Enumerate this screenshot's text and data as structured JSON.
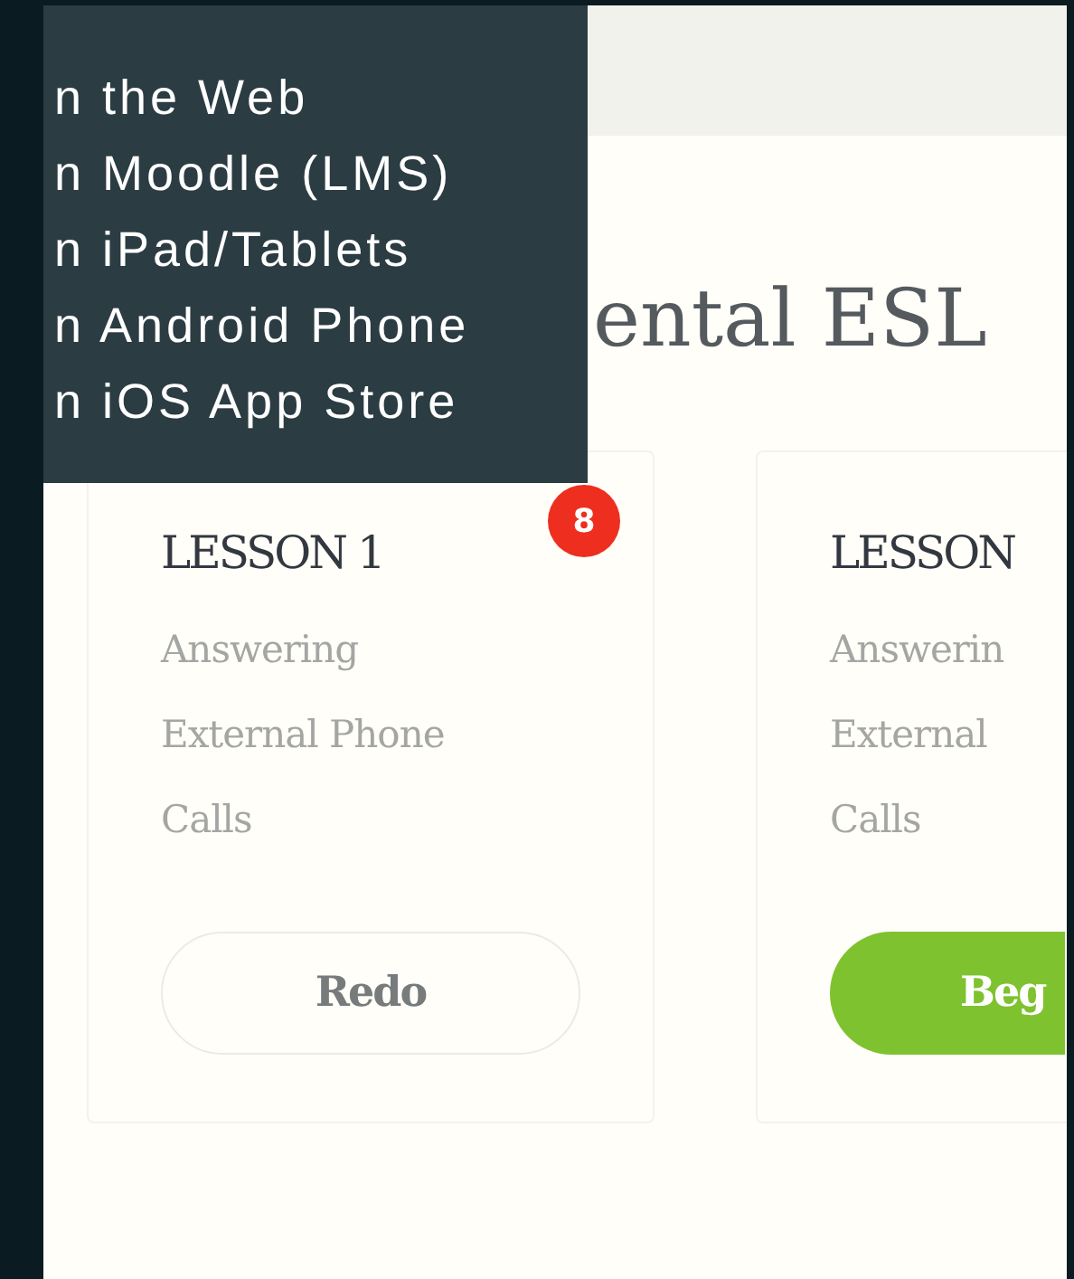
{
  "title": "ental ESL",
  "menu": {
    "items": [
      "n the Web",
      "n Moodle (LMS)",
      "n iPad/Tablets",
      "n Android Phone",
      "n iOS App Store"
    ]
  },
  "lessons": [
    {
      "title": "LESSON 1",
      "badge": "8",
      "description": [
        "Answering",
        "External Phone",
        "Calls"
      ],
      "button": {
        "label": "Redo",
        "kind": "outline"
      }
    },
    {
      "title": "LESSON",
      "description": [
        "Answerin",
        "External",
        "Calls"
      ],
      "button": {
        "label": "Beg",
        "kind": "primary"
      }
    }
  ]
}
